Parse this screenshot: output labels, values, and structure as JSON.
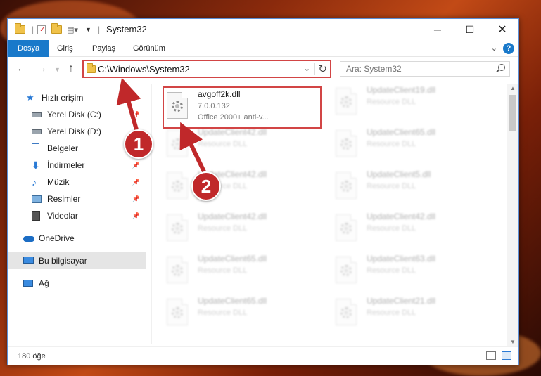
{
  "window": {
    "title": "System32"
  },
  "ribbon": {
    "tabs": [
      "Dosya",
      "Giriş",
      "Paylaş",
      "Görünüm"
    ],
    "help_label": "?"
  },
  "nav": {
    "address_path": "C:\\Windows\\System32",
    "search_placeholder": "Ara: System32"
  },
  "sidebar": {
    "items": [
      {
        "label": "Hızlı erişim",
        "icon": "star-icon"
      },
      {
        "label": "Yerel Disk (C:)",
        "icon": "drive-icon"
      },
      {
        "label": "Yerel Disk (D:)",
        "icon": "drive-icon"
      },
      {
        "label": "Belgeler",
        "icon": "document-icon"
      },
      {
        "label": "İndirmeler",
        "icon": "download-icon"
      },
      {
        "label": "Müzik",
        "icon": "music-icon"
      },
      {
        "label": "Resimler",
        "icon": "image-icon"
      },
      {
        "label": "Videolar",
        "icon": "video-icon"
      },
      {
        "label": "OneDrive",
        "icon": "cloud-icon"
      },
      {
        "label": "Bu bilgisayar",
        "icon": "computer-icon"
      },
      {
        "label": "Ağ",
        "icon": "network-icon"
      }
    ]
  },
  "files": {
    "main": {
      "name": "avgoff2k.dll",
      "version": "7.0.0.132",
      "desc": "Office 2000+ anti-v..."
    },
    "others": [
      {
        "name": "UpdateClient19.dll",
        "desc": "Resource DLL"
      },
      {
        "name": "UpdateClient42.dll",
        "desc": "Resource DLL"
      },
      {
        "name": "UpdateClient65.dll",
        "desc": "Resource DLL"
      },
      {
        "name": "UpdateClient42.dll",
        "desc": "Resource DLL"
      },
      {
        "name": "UpdateClient5.dll",
        "desc": "Resource DLL"
      },
      {
        "name": "UpdateClient42.dll",
        "desc": "Resource DLL"
      },
      {
        "name": "UpdateClient42.dll",
        "desc": "Resource DLL"
      },
      {
        "name": "UpdateClient65.dll",
        "desc": "Resource DLL"
      },
      {
        "name": "UpdateClient63.dll",
        "desc": "Resource DLL"
      },
      {
        "name": "UpdateClient65.dll",
        "desc": "Resource DLL"
      },
      {
        "name": "UpdateClient21.dll",
        "desc": "Resource DLL"
      }
    ]
  },
  "status": {
    "item_count": "180 öğe"
  },
  "annotations": {
    "step1": "1",
    "step2": "2",
    "color": "#c0282a"
  }
}
